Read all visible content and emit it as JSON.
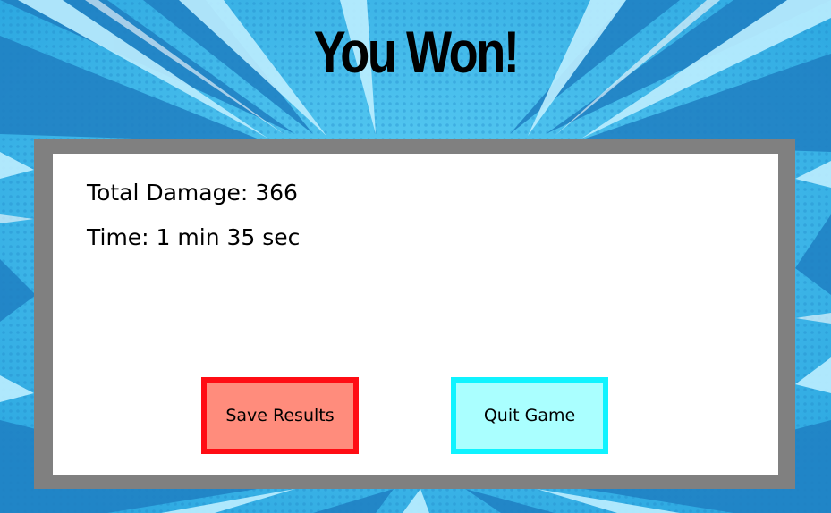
{
  "screen": {
    "title": "You Won!"
  },
  "results": {
    "damage_label": "Total Damage: 366",
    "time_label": "Time: 1 min 35 sec"
  },
  "buttons": {
    "save_label": "Save Results",
    "quit_label": "Quit Game"
  },
  "colors": {
    "background_primary": "#36b8ea",
    "background_light": "#8fdcf8",
    "background_dark": "#1e86c8",
    "panel_border": "#808080",
    "panel_fill": "#ffffff",
    "save_fill": "#ff8c7c",
    "save_border": "#ff0d14",
    "quit_fill": "#aaffff",
    "quit_border": "#10f3ff"
  }
}
